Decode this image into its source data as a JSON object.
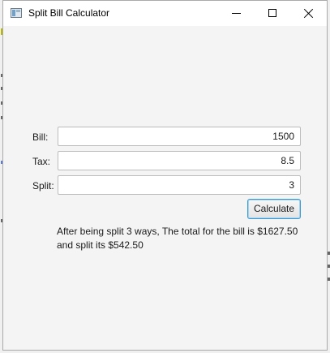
{
  "window": {
    "title": "Split Bill Calculator"
  },
  "form": {
    "bill_label": "Bill:",
    "bill_value": "1500",
    "tax_label": "Tax:",
    "tax_value": "8.5",
    "split_label": "Split:",
    "split_value": "3",
    "calculate_label": "Calculate"
  },
  "result": {
    "line1": "After being split 3 ways, The total for the bill is $1627.50",
    "line2": "and split its $542.50"
  },
  "icons": [
    "app-icon",
    "minimize-icon",
    "maximize-icon",
    "close-icon"
  ]
}
